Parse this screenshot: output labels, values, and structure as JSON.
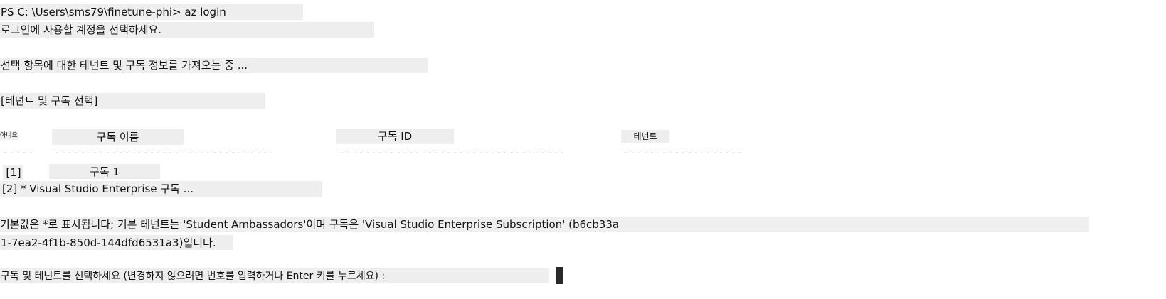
{
  "terminal": {
    "prompt_line": "PS C: \\Users\\sms79\\finetune-phi> az login",
    "select_account": "로그인에 사용할 계정을 선택하세요.",
    "retrieving": "선택 항목에 대한 테넌트 및 구독 정보를 가져오는 중 ...",
    "section_title": "[테넌트 및 구독 선택]",
    "table": {
      "col_no": "아니요",
      "col_name": "구독 이름",
      "col_id": "구독 ID",
      "col_tenant": "테넌트",
      "sep_no": "-----",
      "sep_name": "-----------------------------------",
      "sep_id": "------------------------------------",
      "sep_tenant": "-------------------",
      "rows": [
        {
          "no": "[1]",
          "name": "구독 1"
        },
        {
          "line": "[2] * Visual Studio Enterprise 구독 ..."
        }
      ]
    },
    "default_line_1": "기본값은 *로 표시됩니다; 기본 테넌트는 'Student Ambassadors'이며 구독은 'Visual Studio Enterprise Subscription' (b6cb33a",
    "default_line_2": "1-7ea2-4f1b-850d-144dfd6531a3)입니다.",
    "prompt_select": "구독 및 테넌트를 선택하세요 (변경하지 않으려면 번호를 입력하거나 Enter 키를 누르세요) :"
  }
}
